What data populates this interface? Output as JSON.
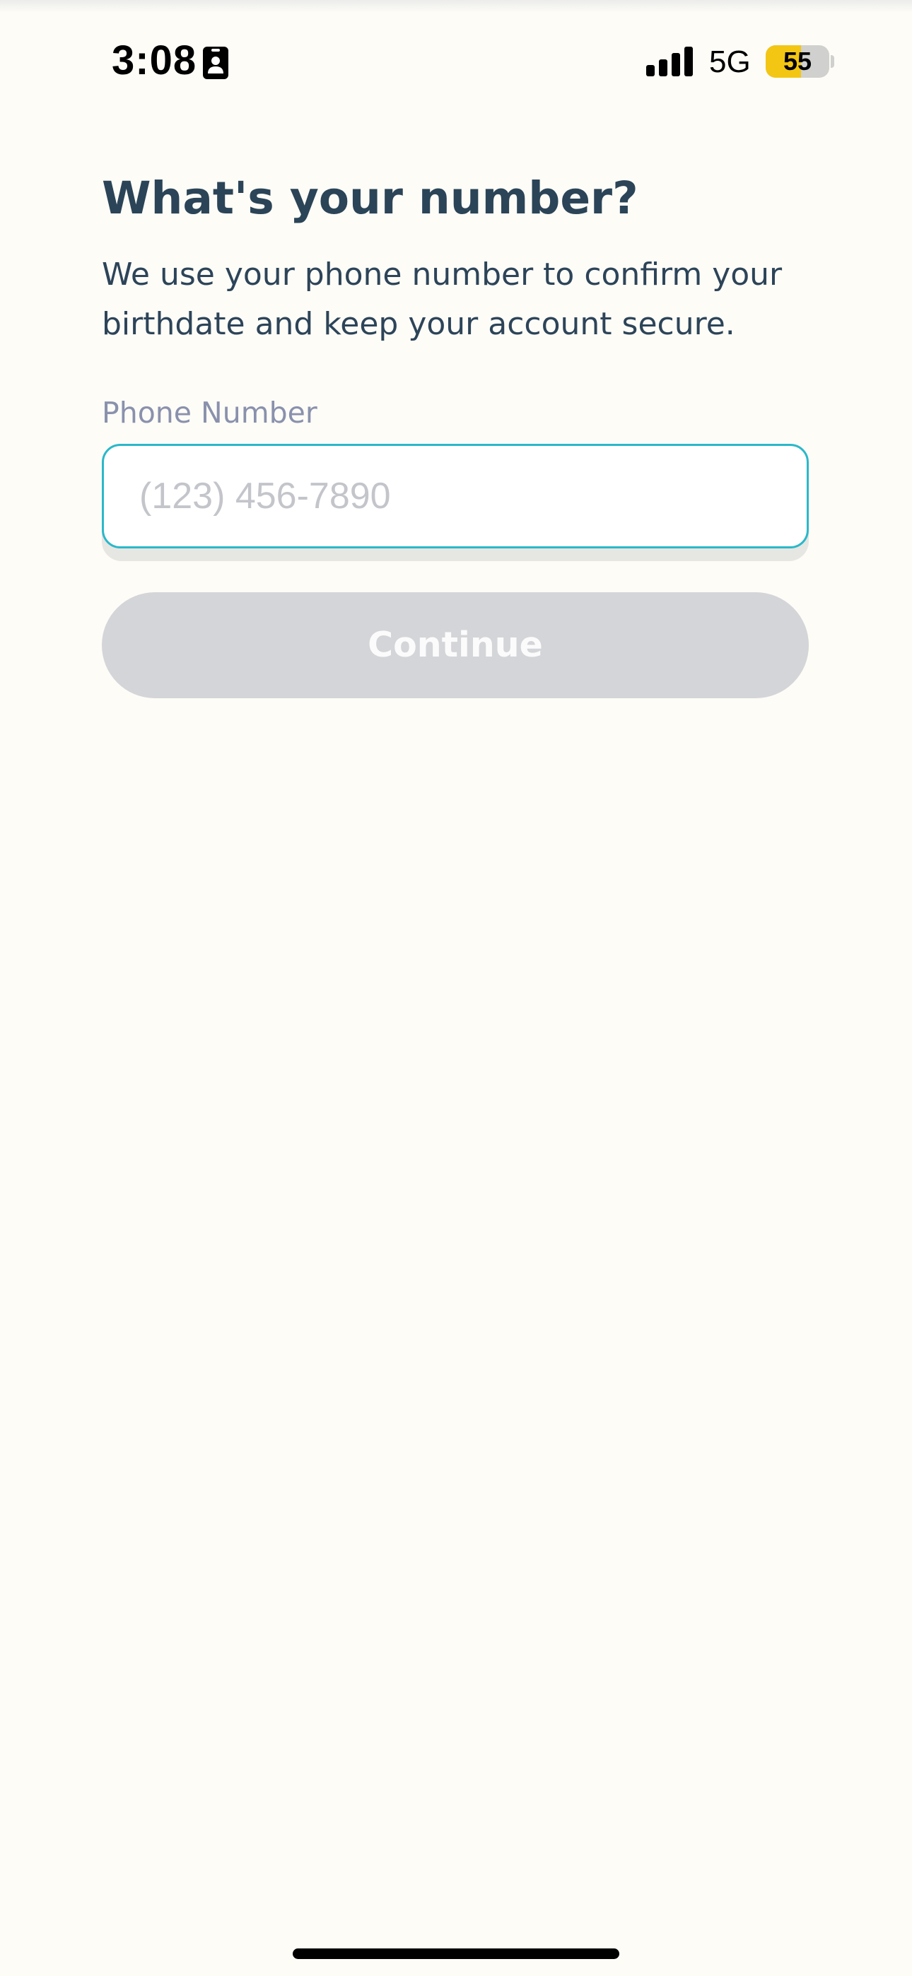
{
  "status_bar": {
    "time": "3:08",
    "time_icon": "id-card-icon",
    "signal_icon": "cellular-signal-icon",
    "network": "5G",
    "battery_level": "55",
    "battery_fraction": 0.55,
    "battery_color": "#f3c614"
  },
  "screen": {
    "title": "What's your number?",
    "subtitle": "We use your phone number to confirm your birthdate and keep your account secure.",
    "phone_field": {
      "label": "Phone Number",
      "placeholder": "(123) 456-7890",
      "value": ""
    },
    "continue_label": "Continue"
  },
  "colors": {
    "background": "#fdfcf7",
    "heading": "#2b4457",
    "label": "#8a91ad",
    "input_border": "#2bb8c9",
    "button_disabled": "#d4d5d8"
  }
}
